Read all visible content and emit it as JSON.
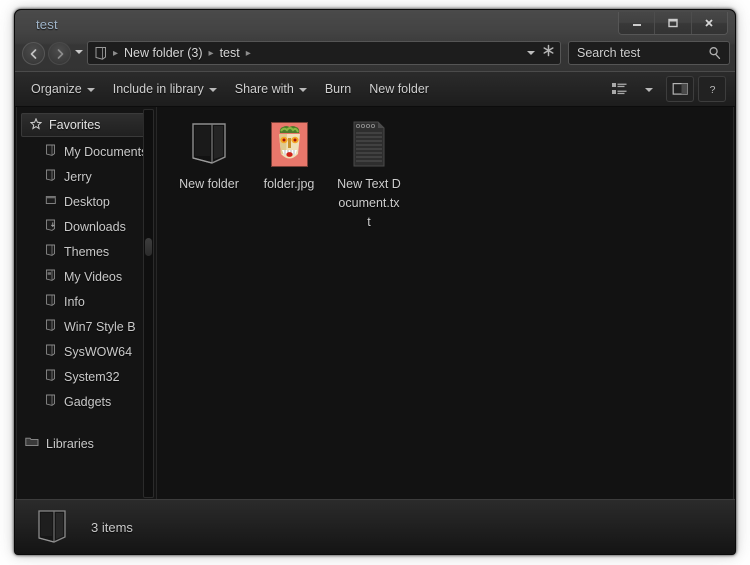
{
  "window": {
    "title": "test",
    "controls": {
      "minimize": "Minimize",
      "maximize": "Maximize",
      "close": "Close"
    }
  },
  "navigation": {
    "back_label": "Back",
    "forward_label": "Forward",
    "recent_label": "Recent locations",
    "breadcrumb": [
      {
        "label": "New folder (3)"
      },
      {
        "label": "test"
      }
    ],
    "previous_locations_label": "Previous locations",
    "refresh_label": "Refresh"
  },
  "search": {
    "placeholder": "Search test",
    "icon": "search-icon"
  },
  "toolbar": {
    "items": [
      {
        "label": "Organize",
        "has_menu": true
      },
      {
        "label": "Include in library",
        "has_menu": true
      },
      {
        "label": "Share with",
        "has_menu": true
      },
      {
        "label": "Burn",
        "has_menu": false
      },
      {
        "label": "New folder",
        "has_menu": false
      }
    ],
    "view_label": "Change your view",
    "preview_label": "Show the preview pane",
    "help_label": "Get help"
  },
  "sidebar": {
    "favorites": {
      "label": "Favorites",
      "icon": "star-icon"
    },
    "items": [
      {
        "label": "My Documents",
        "icon": "folder-icon"
      },
      {
        "label": "Jerry",
        "icon": "folder-icon"
      },
      {
        "label": "Desktop",
        "icon": "desktop-icon"
      },
      {
        "label": "Downloads",
        "icon": "downloads-icon"
      },
      {
        "label": "Themes",
        "icon": "folder-icon"
      },
      {
        "label": "My Videos",
        "icon": "folder-icon"
      },
      {
        "label": "Info",
        "icon": "folder-icon"
      },
      {
        "label": "Win7 Style B",
        "icon": "folder-icon"
      },
      {
        "label": "SysWOW64",
        "icon": "folder-icon"
      },
      {
        "label": "System32",
        "icon": "folder-icon"
      },
      {
        "label": "Gadgets",
        "icon": "folder-icon"
      }
    ],
    "libraries": {
      "label": "Libraries",
      "icon": "libraries-icon"
    }
  },
  "files": [
    {
      "name": "New folder",
      "icon": "folder-icon",
      "type": "folder"
    },
    {
      "name": "folder.jpg",
      "icon": "image-thumbnail",
      "type": "image"
    },
    {
      "name": "New Text Document.txt",
      "icon": "text-file-icon",
      "type": "text"
    }
  ],
  "status": {
    "item_count": "3 items",
    "icon": "folder-icon"
  },
  "colors": {
    "window_background": "#1b1b1b",
    "content_background": "#121212",
    "title_text": "#9fb4c8",
    "body_text": "#cdcdcd",
    "thumbnail_background": "#e8776b"
  }
}
